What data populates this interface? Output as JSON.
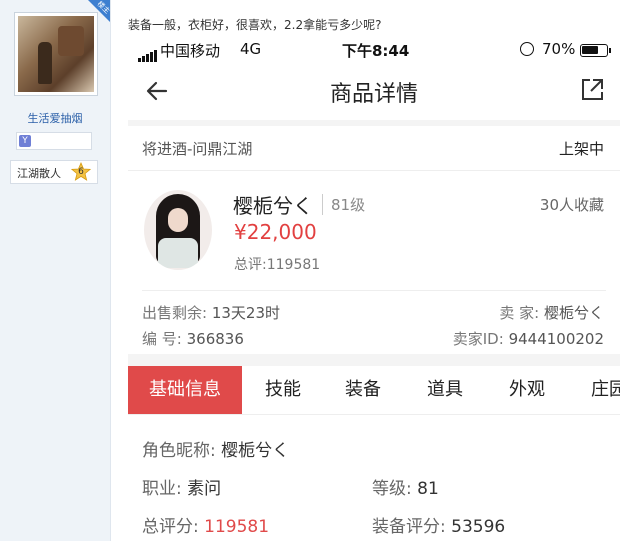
{
  "forum": {
    "badge": "楼主",
    "username": "生活爱抽烟",
    "level_icon": "Y",
    "rank_title": "江湖散人",
    "rank_level": "6",
    "post_text": "装备一般，衣柜好，很喜欢，2.2拿能亏多少呢?"
  },
  "status_bar": {
    "carrier": "中国移动",
    "network": "4G",
    "time": "下午8:44",
    "battery_pct": "70%",
    "battery_level": 0.7
  },
  "navbar": {
    "title": "商品详情",
    "back_icon": "back-arrow-icon",
    "share_icon": "share-icon"
  },
  "listing": {
    "server": "将进酒-问鼎江湖",
    "status": "上架中",
    "character_name": "樱栀兮く",
    "level": "81级",
    "favorites": "30人收藏",
    "price": "¥22,000",
    "total_score": "总评:119581",
    "time_left_label": "出售剩余:",
    "time_left": "13天23时",
    "seller_label": "卖  家:",
    "seller": "樱栀兮く",
    "number_label": "编  号:",
    "number": "366836",
    "seller_id_label": "卖家ID:",
    "seller_id": "9444100202"
  },
  "tabs": [
    "基础信息",
    "技能",
    "装备",
    "道具",
    "外观",
    "庄园"
  ],
  "basic_info": {
    "nickname_label": "角色昵称:",
    "nickname": "樱栀兮く",
    "job_label": "职业:",
    "job": "素问",
    "level_label": "等级:",
    "level": "81",
    "total_score_label": "总评分:",
    "total_score": "119581",
    "equip_score_label": "装备评分:",
    "equip_score": "53596"
  },
  "colors": {
    "accent": "#e04a4a",
    "link": "#2a5fa8"
  }
}
